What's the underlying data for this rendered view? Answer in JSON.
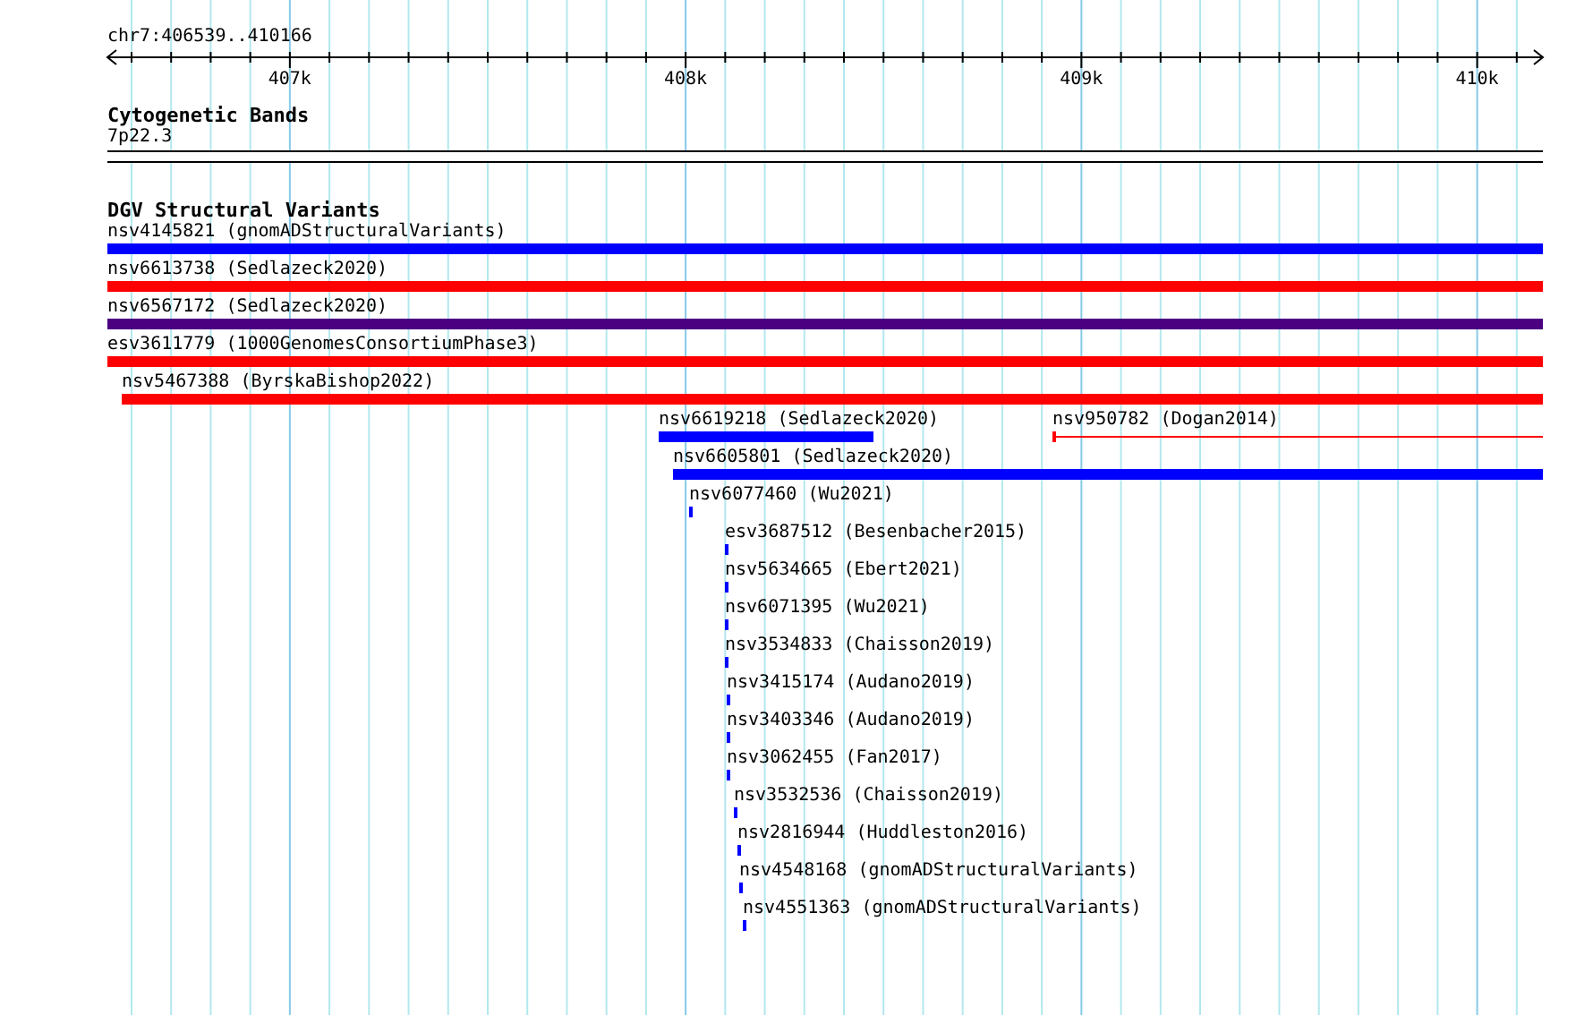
{
  "ruler": {
    "region": "chr7:406539..410166",
    "ticks": [
      "407k",
      "408k",
      "409k",
      "410k"
    ]
  },
  "cytoband_track": {
    "title": "Cytogenetic Bands",
    "band": "7p22.3"
  },
  "dgv_track": {
    "title": "DGV Structural Variants",
    "rows": [
      {
        "features": [
          {
            "label": "nsv4145821 (gnomADStructuralVariants)",
            "kind": "bar",
            "color": "#0000ff"
          }
        ]
      },
      {
        "features": [
          {
            "label": "nsv6613738 (Sedlazeck2020)",
            "kind": "bar",
            "color": "#ff0000"
          }
        ]
      },
      {
        "features": [
          {
            "label": "nsv6567172 (Sedlazeck2020)",
            "kind": "bar",
            "color": "#4b0082"
          }
        ]
      },
      {
        "features": [
          {
            "label": "esv3611779 (1000GenomesConsortiumPhase3)",
            "kind": "bar",
            "color": "#ff0000"
          }
        ]
      },
      {
        "features": [
          {
            "label": "nsv5467388 (ByrskaBishop2022)",
            "kind": "bar",
            "color": "#ff0000"
          }
        ]
      },
      {
        "features": [
          {
            "label": "nsv6619218 (Sedlazeck2020)",
            "kind": "bar",
            "color": "#0000ff"
          },
          {
            "label": "nsv950782 (Dogan2014)",
            "kind": "line",
            "color": "#ff0000"
          }
        ]
      },
      {
        "features": [
          {
            "label": "nsv6605801 (Sedlazeck2020)",
            "kind": "bar",
            "color": "#0000ff"
          }
        ]
      },
      {
        "features": [
          {
            "label": "nsv6077460 (Wu2021)",
            "kind": "bar",
            "color": "#0000ff"
          }
        ]
      },
      {
        "features": [
          {
            "label": "esv3687512 (Besenbacher2015)",
            "kind": "bar",
            "color": "#0000ff"
          }
        ]
      },
      {
        "features": [
          {
            "label": "nsv5634665 (Ebert2021)",
            "kind": "bar",
            "color": "#0000ff"
          }
        ]
      },
      {
        "features": [
          {
            "label": "nsv6071395 (Wu2021)",
            "kind": "bar",
            "color": "#0000ff"
          }
        ]
      },
      {
        "features": [
          {
            "label": "nsv3534833 (Chaisson2019)",
            "kind": "bar",
            "color": "#0000ff"
          }
        ]
      },
      {
        "features": [
          {
            "label": "nsv3415174 (Audano2019)",
            "kind": "bar",
            "color": "#0000ff"
          }
        ]
      },
      {
        "features": [
          {
            "label": "nsv3403346 (Audano2019)",
            "kind": "bar",
            "color": "#0000ff"
          }
        ]
      },
      {
        "features": [
          {
            "label": "nsv3062455 (Fan2017)",
            "kind": "bar",
            "color": "#0000ff"
          }
        ]
      },
      {
        "features": [
          {
            "label": "nsv3532536 (Chaisson2019)",
            "kind": "bar",
            "color": "#0000ff"
          }
        ]
      },
      {
        "features": [
          {
            "label": "nsv2816944 (Huddleston2016)",
            "kind": "bar",
            "color": "#0000ff"
          }
        ]
      },
      {
        "features": [
          {
            "label": "nsv4548168 (gnomADStructuralVariants)",
            "kind": "bar",
            "color": "#0000ff"
          }
        ]
      },
      {
        "features": [
          {
            "label": "nsv4551363 (gnomADStructuralVariants)",
            "kind": "bar",
            "color": "#0000ff"
          }
        ]
      }
    ]
  }
}
